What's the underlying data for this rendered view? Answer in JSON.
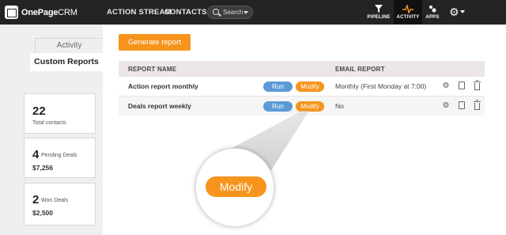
{
  "app": {
    "logo_bold": "OnePage",
    "logo_light": "CRM"
  },
  "nav": {
    "links": [
      "ACTION STREAM",
      "CONTACTS"
    ],
    "search_placeholder": "Search",
    "right_tabs": [
      {
        "label": "PIPELINE",
        "icon": "funnel-icon"
      },
      {
        "label": "ACTIVITY",
        "icon": "pulse-icon",
        "active": true
      },
      {
        "label": "APPS",
        "icon": "apps-icon"
      }
    ]
  },
  "sidebar": {
    "tabs": [
      "Activity",
      "Custom Reports"
    ],
    "stats": [
      {
        "value": "22",
        "label": "Total contacts",
        "amount": ""
      },
      {
        "value": "4",
        "label": "Pending Deals",
        "amount": "$7,256"
      },
      {
        "value": "2",
        "label": "Won Deals",
        "amount": "$2,500"
      }
    ]
  },
  "main": {
    "generate_label": "Generate report",
    "columns": [
      "REPORT NAME",
      "EMAIL REPORT"
    ],
    "rows": [
      {
        "name": "Action report monthly",
        "run": "Run",
        "modify": "Modify",
        "email": "Monthly (First Monday at 7:00)"
      },
      {
        "name": "Deals report weekly",
        "run": "Run",
        "modify": "Modify",
        "email": "No"
      }
    ]
  },
  "callout": {
    "label": "Modify"
  },
  "colors": {
    "accent": "#f7941d",
    "run": "#5b9bd5",
    "topbar": "#242424"
  }
}
